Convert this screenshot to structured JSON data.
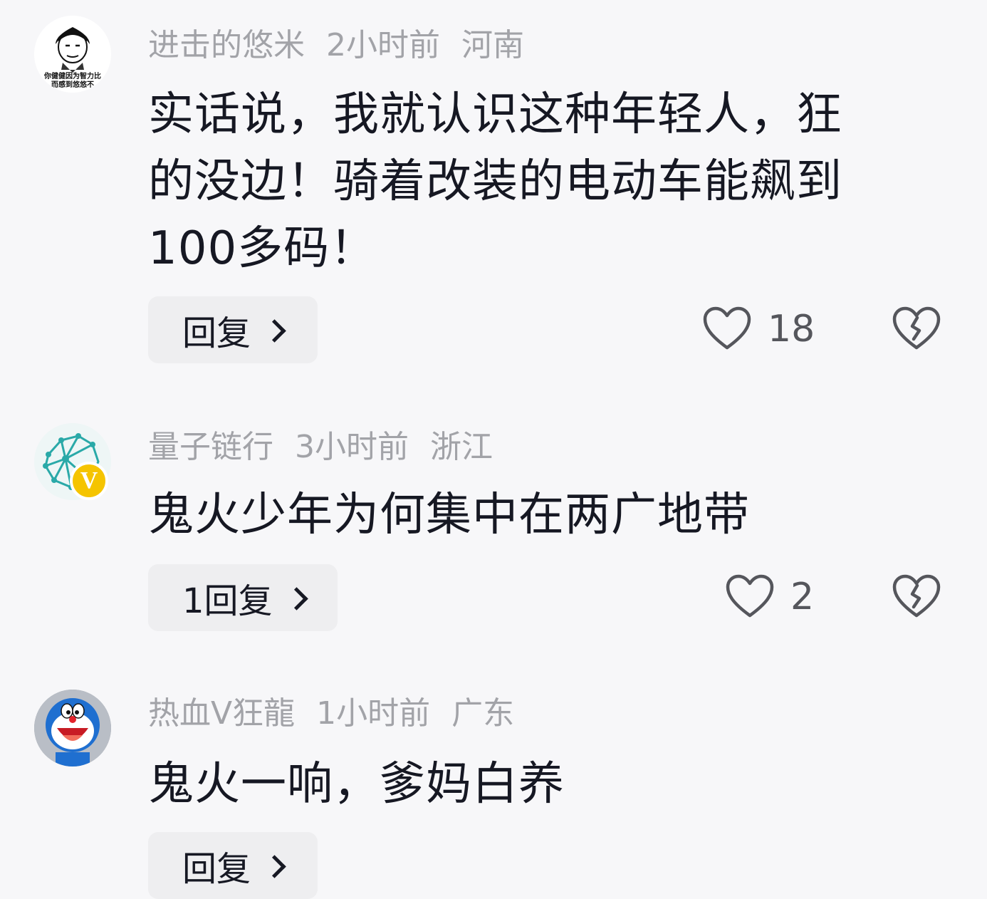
{
  "comments": [
    {
      "username": "进击的悠米",
      "time": "2小时前",
      "location": "河南",
      "text": "实话说，我就认识这种年轻人，狂的没边！骑着改装的电动车能飙到100多码！",
      "text_lines": [
        "实话说，我就认识这种年轻人，狂",
        "的没边！骑着改装的电动车能飙到",
        "100多码！"
      ],
      "reply_label": "回复",
      "likes": "18",
      "avatar_caption_1": "你健健因为智力比",
      "avatar_caption_2": "而感到悠悠不"
    },
    {
      "username": "量子链行",
      "time": "3小时前",
      "location": "浙江",
      "text": "鬼火少年为何集中在两广地带",
      "text_lines": [
        "鬼火少年为何集中在两广地带"
      ],
      "reply_label": "1回复",
      "likes": "2",
      "badge": "V"
    },
    {
      "username": "热血V狂龍",
      "time": "1小时前",
      "location": "广东",
      "text": "鬼火一响，爹妈白养",
      "text_lines": [
        "鬼火一响，爹妈白养"
      ],
      "reply_label": "回复"
    }
  ],
  "colors": {
    "background": "#f7f7f9",
    "text": "#161823",
    "meta": "#a2a3a8",
    "pill": "#eeeef0",
    "badge": "#f5c400"
  },
  "icons": {
    "like": "heart-outline-icon",
    "dislike": "broken-heart-icon",
    "reply": "chevron-right-icon"
  }
}
